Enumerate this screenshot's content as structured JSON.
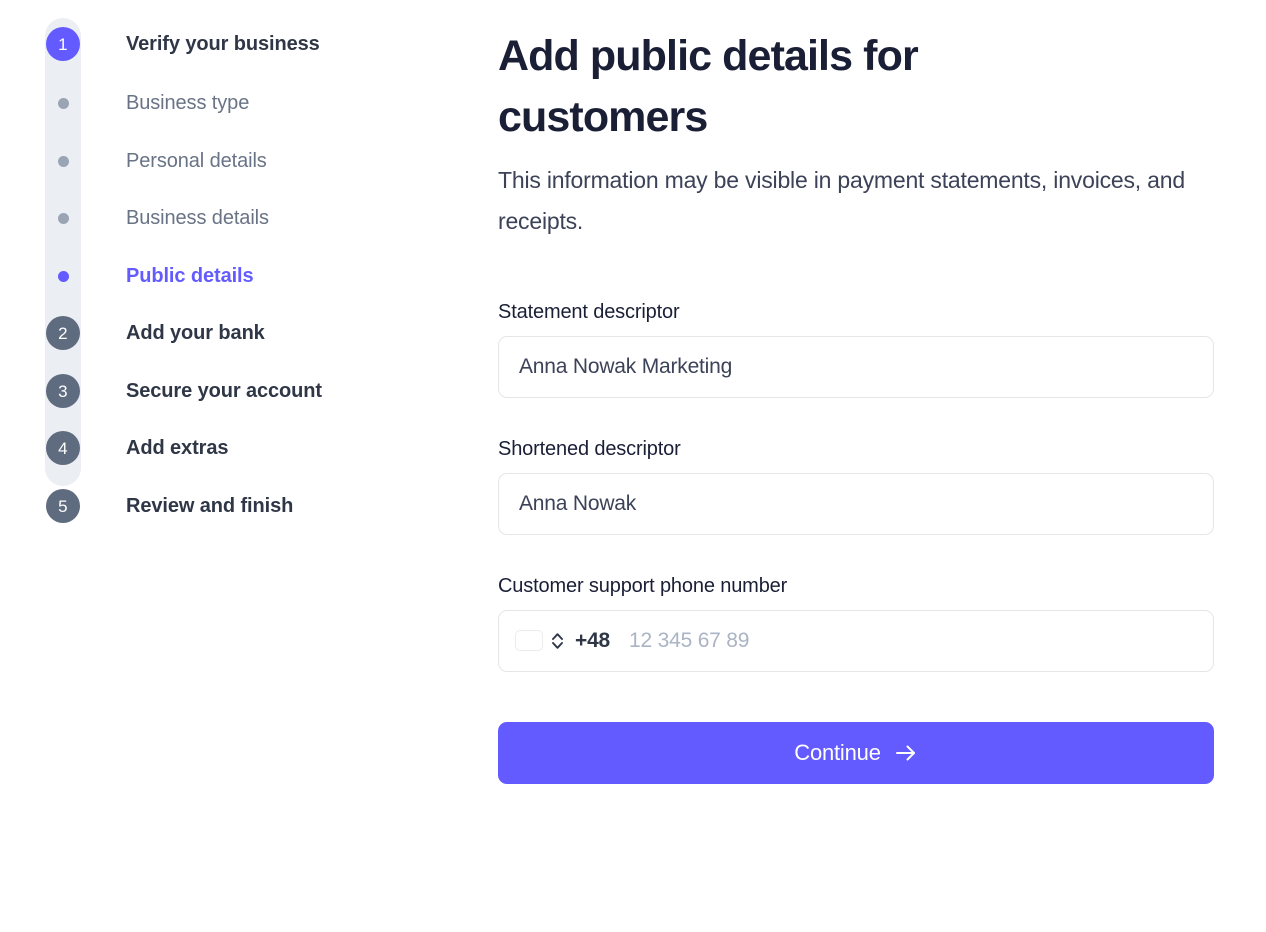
{
  "stepper": {
    "steps": [
      {
        "number": "1",
        "label": "Verify your business",
        "state": "current",
        "substeps": [
          {
            "label": "Business type",
            "state": "done"
          },
          {
            "label": "Personal details",
            "state": "done"
          },
          {
            "label": "Business details",
            "state": "done"
          },
          {
            "label": "Public details",
            "state": "active"
          }
        ]
      },
      {
        "number": "2",
        "label": "Add your bank",
        "state": "upcoming",
        "substeps": []
      },
      {
        "number": "3",
        "label": "Secure your account",
        "state": "upcoming",
        "substeps": []
      },
      {
        "number": "4",
        "label": "Add extras",
        "state": "upcoming",
        "substeps": []
      },
      {
        "number": "5",
        "label": "Review and finish",
        "state": "upcoming",
        "substeps": []
      }
    ]
  },
  "main": {
    "title": "Add public details for customers",
    "subtitle": "This information may be visible in payment statements, invoices, and receipts.",
    "fields": {
      "statement_descriptor": {
        "label": "Statement descriptor",
        "value": "Anna Nowak Marketing",
        "placeholder": ""
      },
      "shortened_descriptor": {
        "label": "Shortened descriptor",
        "value": "Anna Nowak",
        "placeholder": ""
      },
      "support_phone": {
        "label": "Customer support phone number",
        "country_flag": "poland-flag-icon",
        "selector_icon": "chevron-up-down-icon",
        "dial_code": "+48",
        "value": "",
        "placeholder": "12 345 67 89"
      }
    },
    "continue_button": {
      "label": "Continue",
      "icon": "arrow-right-icon"
    }
  },
  "colors": {
    "accent": "#635bff",
    "step_upcoming": "#5f6b7f",
    "rail": "#ebeef3",
    "text_dark": "#1a1f36",
    "text_muted": "#697386",
    "placeholder": "#aab4c4",
    "border": "#e6e6e8",
    "flag_red": "#e8544d",
    "flag_white": "#f5f6f8"
  }
}
